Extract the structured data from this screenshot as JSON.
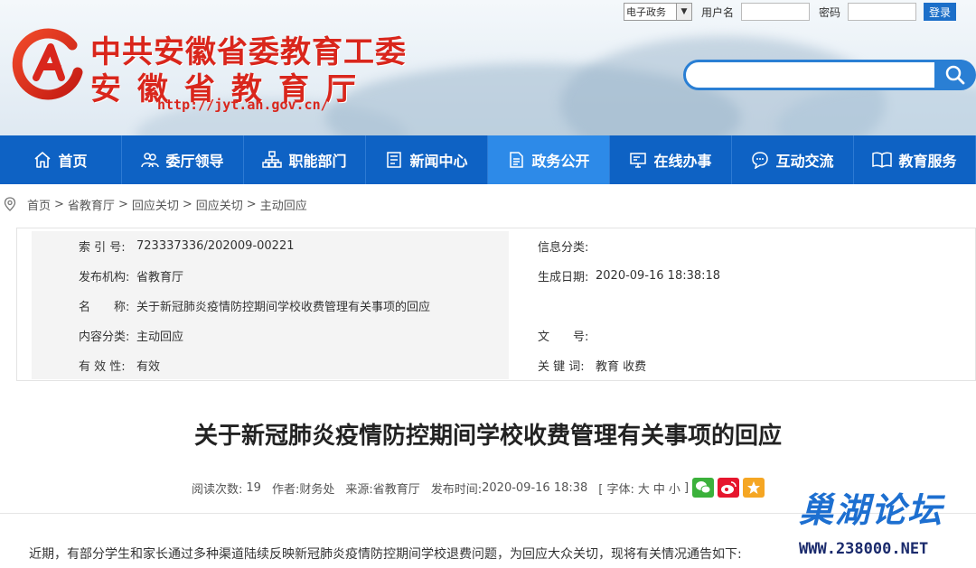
{
  "site": {
    "title_line1": "中共安徽省委教育工委",
    "title_line2": "安徽省教育厅",
    "url": "http://jyt.ah.gov.cn/"
  },
  "login": {
    "select_value": "电子政务",
    "username_label": "用户名",
    "password_label": "密码",
    "login_button": "登录"
  },
  "nav": {
    "items": [
      {
        "label": "首页",
        "icon": "home-icon"
      },
      {
        "label": "委厅领导",
        "icon": "leaders-icon"
      },
      {
        "label": "职能部门",
        "icon": "org-icon"
      },
      {
        "label": "新闻中心",
        "icon": "news-icon"
      },
      {
        "label": "政务公开",
        "icon": "document-icon"
      },
      {
        "label": "在线办事",
        "icon": "monitor-icon"
      },
      {
        "label": "互动交流",
        "icon": "chat-icon"
      },
      {
        "label": "教育服务",
        "icon": "book-icon"
      }
    ],
    "active_index": 4
  },
  "breadcrumb": {
    "items": [
      "首页",
      "省教育厅",
      "回应关切",
      "回应关切",
      "主动回应"
    ],
    "separator": ">"
  },
  "info": {
    "index_label": "索 引 号:",
    "index_value": "723337336/202009-00221",
    "category_label": "信息分类:",
    "category_value": "",
    "publisher_label": "发布机构:",
    "publisher_value": "省教育厅",
    "gen_date_label": "生成日期:",
    "gen_date_value": "2020-09-16 18:38:18",
    "name_label": "名　　称:",
    "name_value": "关于新冠肺炎疫情防控期间学校收费管理有关事项的回应",
    "content_class_label": "内容分类:",
    "content_class_value": "主动回应",
    "doc_no_label": "文　　号:",
    "doc_no_value": "",
    "validity_label": "有 效 性:",
    "validity_value": "有效",
    "keywords_label": "关 键 词:",
    "keywords_value": "教育 收费"
  },
  "article": {
    "title": "关于新冠肺炎疫情防控期间学校收费管理有关事项的回应",
    "reads_label": "阅读次数:",
    "reads_value": "19",
    "author_label": "作者:",
    "author_value": "财务处",
    "source_label": "来源:",
    "source_value": "省教育厅",
    "time_label": "发布时间:",
    "time_value": "2020-09-16 18:38",
    "font_label": "[ 字体:",
    "font_big": "大",
    "font_mid": "中",
    "font_small": "小",
    "font_end": "]",
    "first_paragraph": "近期，有部分学生和家长通过多种渠道陆续反映新冠肺炎疫情防控期间学校退费问题，为回应大众关切，现将有关情况通告如下:"
  },
  "share": {
    "wechat_color": "#3bb13b",
    "weibo_color": "#e6162d",
    "favorite_color": "#f5a623"
  },
  "watermark": {
    "line1": "巢湖论坛",
    "line2": "WWW.238000.NET"
  },
  "colors": {
    "brand_red": "#d9261c",
    "nav_blue": "#0e62c4",
    "nav_active": "#2d8ae8",
    "accent_blue": "#2a7fd4"
  }
}
